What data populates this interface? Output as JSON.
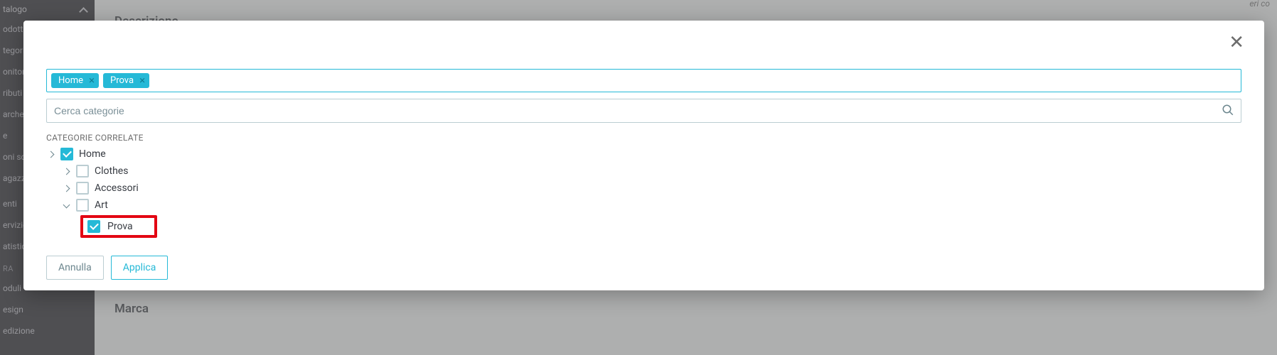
{
  "sidebar": {
    "head": "talogo",
    "items": [
      "odotti",
      "tegorie",
      "onitora",
      "ributi e",
      "arche &",
      "e",
      "oni sco",
      "agazzin"
    ],
    "items2": [
      "enti",
      "ervizio c",
      "atistich"
    ],
    "section": "RA",
    "items3": [
      "oduli",
      "esign",
      "edizione"
    ]
  },
  "background": {
    "heading1": "Descrizione",
    "heading2": "Marca",
    "counter": "eri co"
  },
  "tags": [
    {
      "label": "Home"
    },
    {
      "label": "Prova"
    }
  ],
  "search": {
    "placeholder": "Cerca categorie"
  },
  "tree": {
    "title": "CATEGORIE CORRELATE",
    "home": "Home",
    "clothes": "Clothes",
    "accessori": "Accessori",
    "art": "Art",
    "prova": "Prova"
  },
  "buttons": {
    "cancel": "Annulla",
    "apply": "Applica"
  }
}
